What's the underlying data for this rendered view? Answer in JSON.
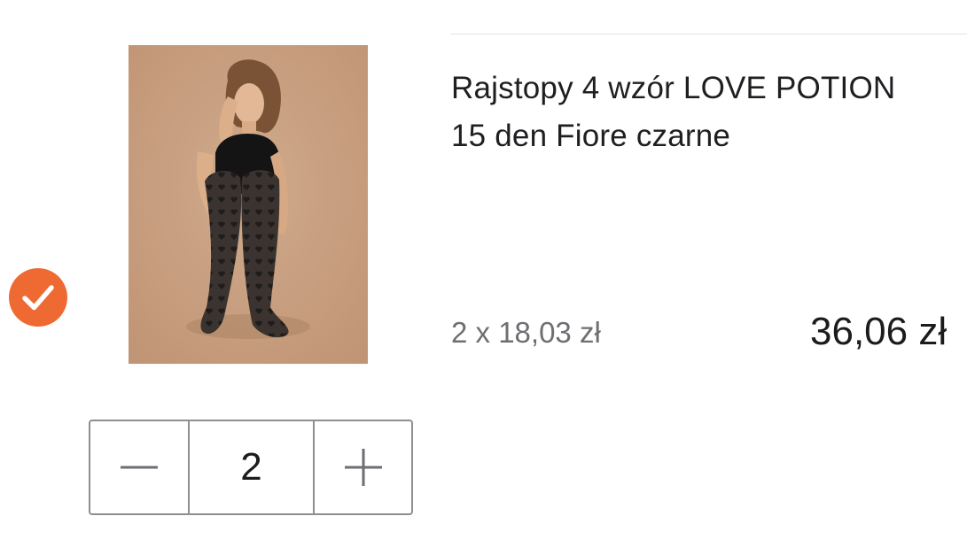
{
  "cart_item": {
    "selected": true,
    "title_line1": "Rajstopy 4 wzór LOVE POTION",
    "title_line2": "15 den Fiore czarne",
    "unit_price_label": "2 x 18,03 zł",
    "total_price": "36,06 zł",
    "quantity": "2"
  },
  "icons": {
    "selected": "checkmark-circle-icon",
    "decrease": "minus-icon",
    "increase": "plus-icon"
  },
  "colors": {
    "accent": "#ef6a32",
    "image_background": "#c8a183",
    "stepper_border": "#8e8e93"
  }
}
